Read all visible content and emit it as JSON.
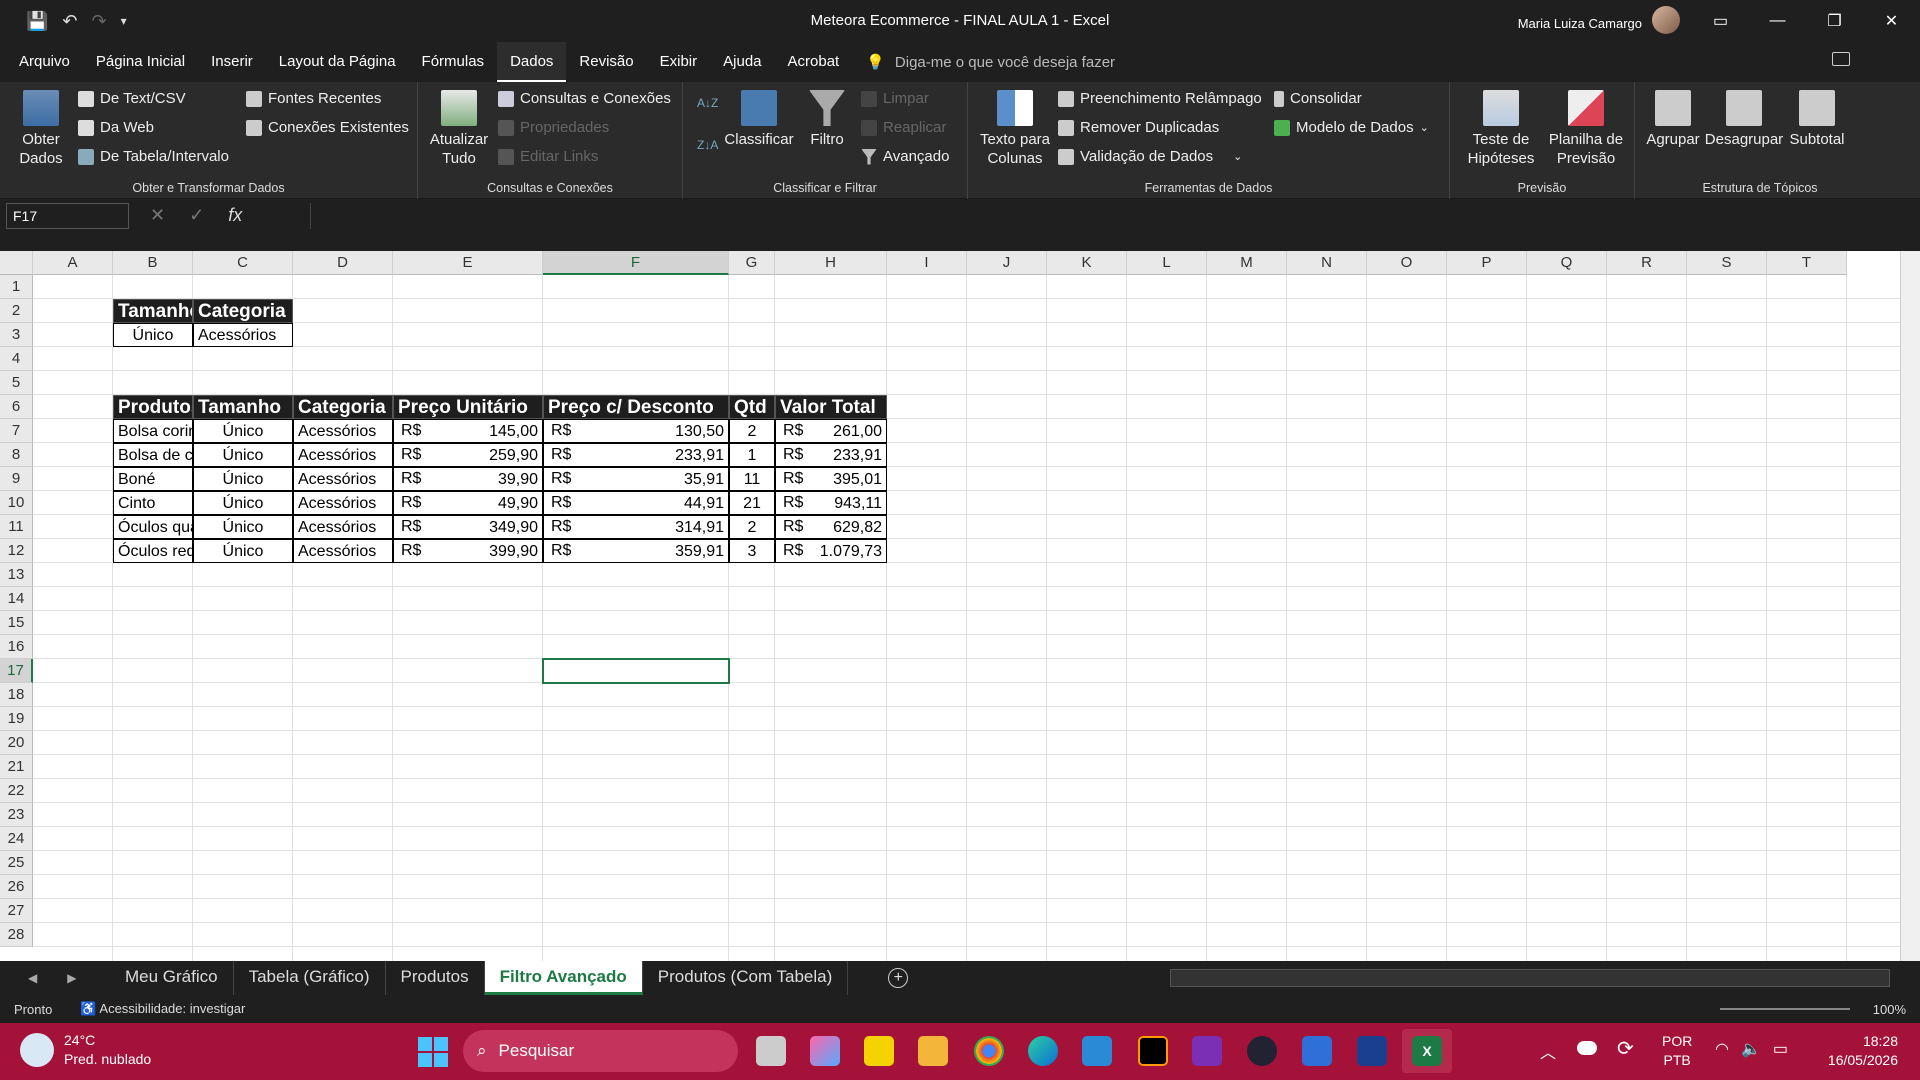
{
  "app": {
    "title": "Meteora Ecommerce - FINAL AULA 1  -  Excel",
    "user": "Maria Luiza Camargo"
  },
  "menu": [
    "Arquivo",
    "Página Inicial",
    "Inserir",
    "Layout da Página",
    "Fórmulas",
    "Dados",
    "Revisão",
    "Exibir",
    "Ajuda",
    "Acrobat"
  ],
  "active_menu": "Dados",
  "tellme": "Diga-me o que você deseja fazer",
  "ribbon": {
    "obter": {
      "big": "Obter\nDados",
      "items": [
        "De Text/CSV",
        "Da Web",
        "De Tabela/Intervalo",
        "Fontes Recentes",
        "Conexões Existentes"
      ],
      "label": "Obter e Transformar Dados"
    },
    "consultas": {
      "big": "Atualizar\nTudo",
      "items": [
        "Consultas e Conexões",
        "Propriedades",
        "Editar Links"
      ],
      "label": "Consultas e Conexões"
    },
    "classificar": {
      "sort": "Classificar",
      "filter": "Filtro",
      "items": [
        "Limpar",
        "Reaplicar",
        "Avançado"
      ],
      "label": "Classificar e Filtrar"
    },
    "ferramentas": {
      "big": "Texto para\nColunas",
      "items": [
        "Preenchimento Relâmpago",
        "Remover Duplicadas",
        "Validação de Dados",
        "Consolidar",
        "Modelo de Dados"
      ],
      "label": "Ferramentas de Dados"
    },
    "previsao": {
      "b1": "Teste de\nHipóteses",
      "b2": "Planilha de\nPrevisão",
      "label": "Previsão"
    },
    "estrutura": {
      "b1": "Agrupar",
      "b2": "Desagrupar",
      "b3": "Subtotal",
      "label": "Estrutura de Tópicos"
    }
  },
  "namebox": "F17",
  "columns": [
    "A",
    "B",
    "C",
    "D",
    "E",
    "F",
    "G",
    "H",
    "I",
    "J",
    "K",
    "L",
    "M",
    "N",
    "O",
    "P",
    "Q",
    "R",
    "S",
    "T"
  ],
  "rows": [
    "1",
    "2",
    "3",
    "4",
    "5",
    "6",
    "7",
    "8",
    "9",
    "10",
    "11",
    "12",
    "13",
    "14",
    "15",
    "16",
    "17",
    "18",
    "19",
    "20",
    "21",
    "22",
    "23",
    "24",
    "25",
    "26",
    "27",
    "28"
  ],
  "criteria": {
    "headers": [
      "Tamanho",
      "Categoria"
    ],
    "values": [
      "Único",
      "Acessórios"
    ]
  },
  "table": {
    "headers": [
      "Produtos",
      "Tamanho",
      "Categoria",
      "Preço Unitário",
      "Preço c/ Desconto",
      "Qtd",
      "Valor Total"
    ],
    "currency": "R$",
    "rows": [
      [
        "Bolsa coringa",
        "Único",
        "Acessórios",
        "145,00",
        "130,50",
        "2",
        "261,00"
      ],
      [
        "Bolsa de couro",
        "Único",
        "Acessórios",
        "259,90",
        "233,91",
        "1",
        "233,91"
      ],
      [
        "Boné",
        "Único",
        "Acessórios",
        "39,90",
        "35,91",
        "11",
        "395,01"
      ],
      [
        "Cinto",
        "Único",
        "Acessórios",
        "49,90",
        "44,91",
        "21",
        "943,11"
      ],
      [
        "Óculos quadrado",
        "Único",
        "Acessórios",
        "349,90",
        "314,91",
        "2",
        "629,82"
      ],
      [
        "Óculos redondo",
        "Único",
        "Acessórios",
        "399,90",
        "359,91",
        "3",
        "1.079,73"
      ]
    ]
  },
  "sheets": [
    "Meu Gráfico",
    "Tabela (Gráfico)",
    "Produtos",
    "Filtro Avançado",
    "Produtos (Com Tabela)"
  ],
  "active_sheet": "Filtro Avançado",
  "status": {
    "ready": "Pronto",
    "access": "Acessibilidade: investigar",
    "zoom": "100%"
  },
  "taskbar": {
    "temp": "24°C",
    "weather": "Pred. nublado",
    "search": "Pesquisar",
    "lang1": "POR",
    "lang2": "PTB",
    "time": "18:28",
    "date": "16/05/2026"
  }
}
